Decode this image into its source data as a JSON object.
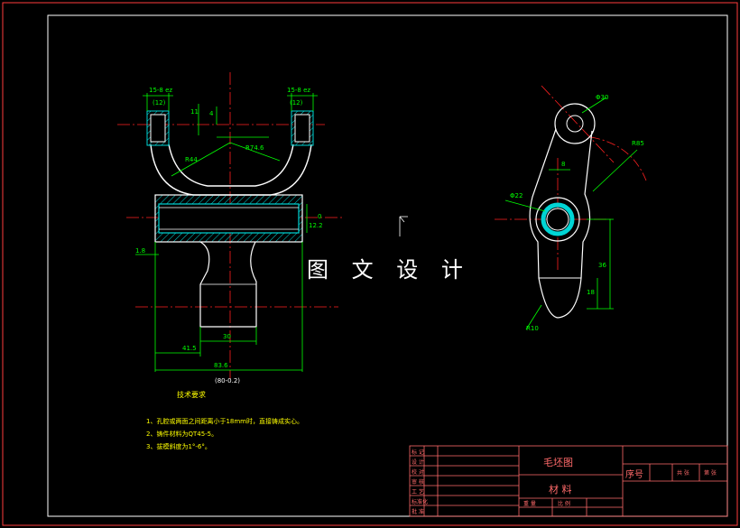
{
  "watermark": "图 文 设 计",
  "dims": {
    "top_left": "15-8 ez",
    "top_left_paren": "(12)",
    "top_right": "15-8 ez",
    "top_right_paren": "(12)",
    "d11": "11",
    "d4": "4",
    "r74": "R74.6",
    "r44": "R44",
    "right_dim": "12.2",
    "right_dim2": "0",
    "left_small": "1.8",
    "d30": "30",
    "d41": "41.5",
    "d83": "83.6",
    "d80": "(80-0.2)",
    "phi30": "Φ30",
    "r85": "R85",
    "d8": "8",
    "phi22": "Φ22",
    "d36": "36",
    "d18": "18",
    "r10": "R10"
  },
  "notes": {
    "title": "技术要求",
    "items": [
      "1、孔腔或两面之间距离小于18mm时，直接铸成实心。",
      "2、铸件材料为QT45-5。",
      "3、拔模斜度为1°-6°。"
    ]
  },
  "title_block": {
    "name": "毛坯图",
    "material": "材  料",
    "seq": "序号",
    "row_labels": [
      "标 记",
      "设 计",
      "校 对",
      "审 核",
      "工 艺",
      "标准化",
      "批 准"
    ],
    "small_labels": [
      "重 量",
      "比 例",
      "共",
      "张",
      "第",
      "张"
    ],
    "right_labels": [
      "共 张",
      "第 张"
    ]
  },
  "colors": {
    "frame": "#ffffff",
    "border": "#ff3b3b",
    "part": "#ffffff",
    "hatch": "#00d5d5",
    "dim": "#00ff00",
    "center": "#ff2020",
    "titleblock": "#ff6a6a",
    "note": "#ffff00"
  }
}
